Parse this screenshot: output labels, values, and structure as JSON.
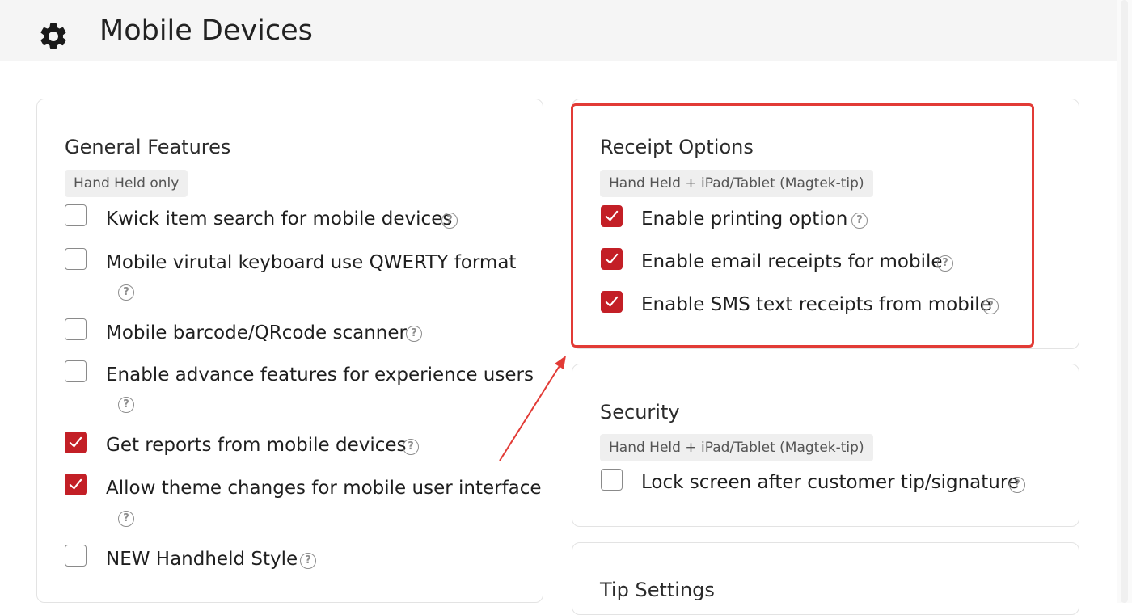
{
  "header": {
    "title": "Mobile Devices",
    "icon": "gear-icon"
  },
  "colors": {
    "accent": "#c31f26",
    "highlight": "#e23b36"
  },
  "general": {
    "title": "General Features",
    "badge": "Hand Held only",
    "items": [
      {
        "label": "Kwick item search for mobile devices",
        "checked": false
      },
      {
        "label": "Mobile virutal keyboard use QWERTY format",
        "checked": false
      },
      {
        "label": "Mobile barcode/QRcode scanner",
        "checked": false
      },
      {
        "label": "Enable advance features for experience users",
        "checked": false
      },
      {
        "label": "Get reports from mobile devices",
        "checked": true
      },
      {
        "label": "Allow theme changes for mobile user interface",
        "checked": true
      },
      {
        "label": "NEW Handheld Style",
        "checked": false
      }
    ]
  },
  "receipt": {
    "title": "Receipt Options",
    "badge": "Hand Held + iPad/Tablet (Magtek-tip)",
    "items": [
      {
        "label": "Enable printing option",
        "checked": true
      },
      {
        "label": "Enable email receipts for mobile",
        "checked": true
      },
      {
        "label": "Enable SMS text receipts from mobile",
        "checked": true
      }
    ]
  },
  "security": {
    "title": "Security",
    "badge": "Hand Held + iPad/Tablet (Magtek-tip)",
    "items": [
      {
        "label": "Lock screen after customer tip/signature",
        "checked": false
      }
    ]
  },
  "tip": {
    "title": "Tip Settings"
  },
  "help_glyph": "?"
}
